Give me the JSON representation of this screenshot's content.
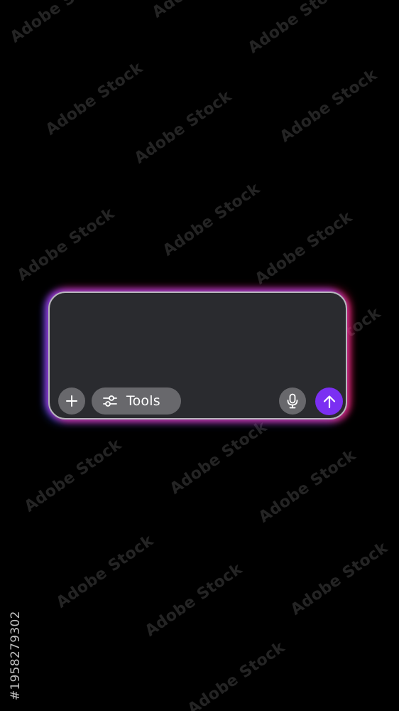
{
  "watermark": {
    "text": "Adobe Stock",
    "stock_id": "#1958279302"
  },
  "chat_input": {
    "value": "",
    "placeholder": "",
    "tools_label": "Tools",
    "icons": {
      "add": "plus-icon",
      "tools": "sliders-icon",
      "mic": "microphone-icon",
      "send": "arrow-up-icon"
    }
  },
  "colors": {
    "background": "#000000",
    "box_fill": "#2a2b2f",
    "box_border": "#b8b6bd",
    "glow_purple": "#aa46ff",
    "glow_pink": "#ff2882",
    "glow_blue": "#3c5aff",
    "pill_button": "#68686c",
    "send_accent": "#7b2ff2"
  }
}
